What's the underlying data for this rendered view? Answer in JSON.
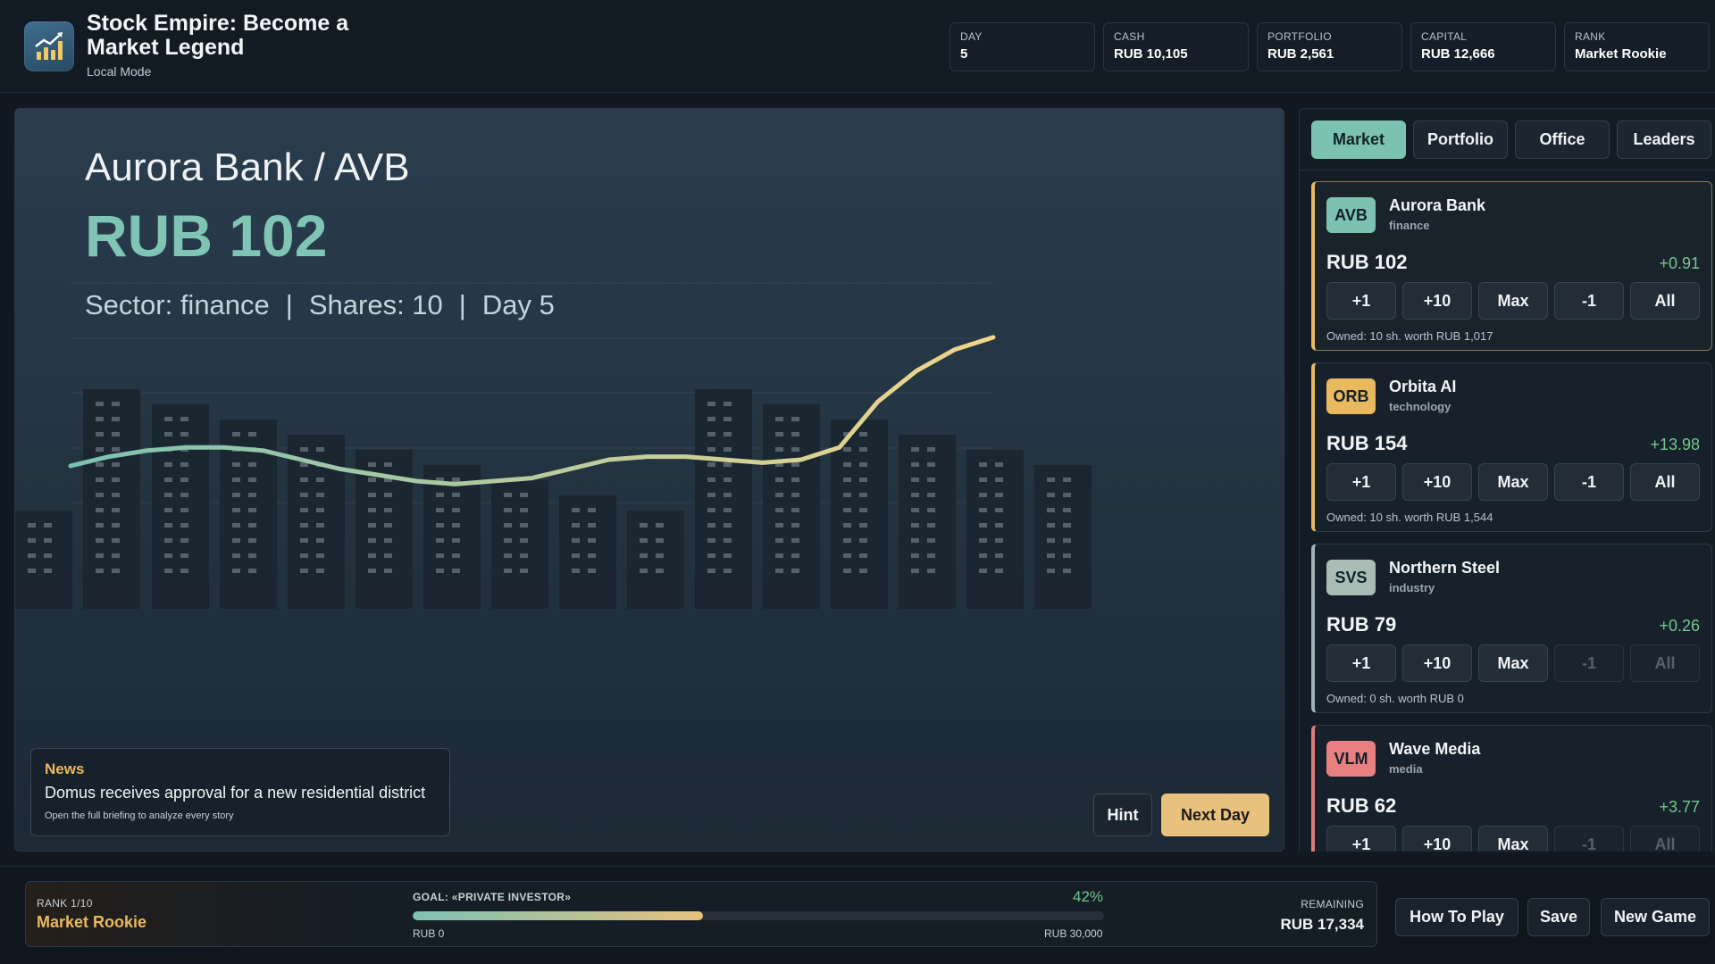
{
  "app": {
    "title": "Stock Empire: Become a Market Legend",
    "mode": "Local Mode",
    "logo_icon": "bar-chart-up-icon"
  },
  "stats": [
    {
      "label": "DAY",
      "value": "5"
    },
    {
      "label": "CASH",
      "value": "RUB 10,105"
    },
    {
      "label": "PORTFOLIO",
      "value": "RUB 2,561"
    },
    {
      "label": "CAPITAL",
      "value": "RUB 12,666"
    },
    {
      "label": "RANK",
      "value": "Market Rookie"
    }
  ],
  "selected_stock": {
    "title": "Aurora Bank / AVB",
    "price": "RUB 102",
    "sector": "Sector: finance",
    "shares": "Shares: 10",
    "day": "Day 5",
    "separator": "|"
  },
  "chart_data": {
    "type": "line",
    "series": [
      {
        "values": [
          79,
          82,
          84,
          85,
          85,
          84,
          81,
          78,
          76,
          74,
          73,
          74,
          75,
          78,
          81,
          82,
          82,
          81,
          80,
          81,
          85,
          100,
          110,
          117,
          121
        ]
      }
    ],
    "grid": true,
    "line_color_start": "#7cc2b3",
    "line_color_end": "#f0d58a"
  },
  "news": {
    "title": "News",
    "text": "Domus receives approval for a new residential district",
    "hint": "Open the full briefing to analyze every story"
  },
  "actions": {
    "hint": "Hint",
    "next_day": "Next Day"
  },
  "tabs": [
    {
      "label": "Market",
      "active": true
    },
    {
      "label": "Portfolio",
      "active": false
    },
    {
      "label": "Office",
      "active": false
    },
    {
      "label": "Leaders",
      "active": false
    }
  ],
  "stocks": [
    {
      "ticker": "AVB",
      "name": "Aurora Bank",
      "sector": "finance",
      "price": "RUB 102",
      "change": "+0.91",
      "owned": "Owned: 10 sh. worth RUB 1,017",
      "color": "#7cc2b3",
      "buttons": [
        "+1",
        "+10",
        "Max",
        "-1",
        "All"
      ],
      "sell_enabled": true
    },
    {
      "ticker": "ORB",
      "name": "Orbita AI",
      "sector": "technology",
      "price": "RUB 154",
      "change": "+13.98",
      "owned": "Owned: 10 sh. worth RUB 1,544",
      "color": "#e8b95e",
      "buttons": [
        "+1",
        "+10",
        "Max",
        "-1",
        "All"
      ],
      "sell_enabled": true
    },
    {
      "ticker": "SVS",
      "name": "Northern Steel",
      "sector": "industry",
      "price": "RUB 79",
      "change": "+0.26",
      "owned": "Owned: 0 sh. worth RUB 0",
      "color": "#a9bdb6",
      "buttons": [
        "+1",
        "+10",
        "Max",
        "-1",
        "All"
      ],
      "sell_enabled": false
    },
    {
      "ticker": "VLM",
      "name": "Wave Media",
      "sector": "media",
      "price": "RUB 62",
      "change": "+3.77",
      "owned": "",
      "color": "#e88080",
      "buttons": [
        "+1",
        "+10",
        "Max",
        "-1",
        "All"
      ],
      "sell_enabled": false
    }
  ],
  "footer": {
    "rank_label": "RANK 1/10",
    "rank_value": "Market Rookie",
    "goal_label": "GOAL: «PRIVATE INVESTOR»",
    "goal_percent": "42%",
    "progress": 0.42,
    "range_min": "RUB 0",
    "range_max": "RUB 30,000",
    "remaining_label": "REMAINING",
    "remaining_value": "RUB 17,334",
    "buttons": {
      "how_to_play": "How To Play",
      "save": "Save",
      "new_game": "New Game"
    }
  }
}
